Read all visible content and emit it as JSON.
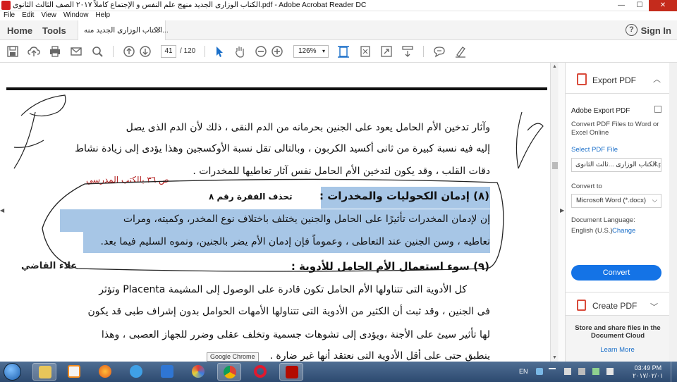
{
  "window": {
    "title": "الكتاب الوزارى الجديد منهج علم النفس و الإجتماع كاملاً ٢٠١٧ الصف الثالث الثانوى.pdf - Adobe Acrobat Reader DC",
    "min": "—",
    "max": "☐",
    "close": "✕"
  },
  "menu": [
    "File",
    "Edit",
    "View",
    "Window",
    "Help"
  ],
  "nav": {
    "home": "Home",
    "tools": "Tools",
    "tab_label": "الكتاب الوزارى الجديد منه...",
    "tab_close": "✕",
    "help": "?",
    "signin": "Sign In"
  },
  "toolbar": {
    "page_current": "41",
    "page_total": "/ 120",
    "zoom": "126%",
    "zoom_arrow": "▾",
    "icons": [
      "save-icon",
      "upload-icon",
      "print-icon",
      "mail-icon",
      "search-icon",
      "page-up-icon",
      "page-down-icon",
      "select-cursor-icon",
      "hand-icon",
      "zoom-out-icon",
      "zoom-in-icon",
      "fit-width-icon",
      "fit-page-icon",
      "full-screen-icon",
      "scroll-mode-icon",
      "comment-icon",
      "highlight-pen-icon"
    ]
  },
  "document": {
    "line1": "وآثار تدخين الأم الحامل يعود على الجنين بحرمانه من الدم النقى ، ذلك لأن الدم الذى يصل",
    "line2": "إليه فيه نسبة كبيرة من ثانى أكسيد الكربون ، وبالتالى تقل نسبة الأوكسجين وهذا يؤدى إلى زيادة نشاط",
    "line3": "دقات القلب ، وقد يكون لتدخين الأم الحامل نفس آثار تعاطيها للمخدرات .",
    "red_note": "ص ٣٦ بالكتب المدرسي",
    "heading8": "(٨) إدمان الكحوليات والمخدرات :",
    "delete_note": "تحذف الفقرة رقم ٨",
    "para8_line1": "إن لإدمان المخدرات تأثيرًا على الحامل والجنين يختلف باختلاف نوع المخدر، وكميته، ومرات",
    "para8_line2": "تعاطيه ، وسن الجنين عند التعاطى ، وعموماً فإن إدمان الأم يضر بالجنين، ونموه السليم فيما بعد.",
    "heading9": "(٩) سوء استعمال الأم الحامل للأدوية :",
    "author": "علاء القاضي",
    "p9_line1": "كل الأدوية التى تتناولها الأم الحامل تكون قادرة على الوصول إلى المشيمة Placenta وتؤثر",
    "p9_line2": "فى الجنين ، وقد ثبت أن الكثير من الأدوية التى تتناولها الأمهات الحوامل بدون إشراف طبى قد يكون",
    "p9_line3": "لها تأثير سيئ على الأجنة ،ويؤدى إلى تشوهات جسمية وتخلف عقلى وضرر للجهاز العصبى ، وهذا",
    "p9_line4": "ينطبق حتى على أقل الأدوية التى نعتقد أنها غير ضارة ."
  },
  "right_panel": {
    "export_header": "Export PDF",
    "export_chevron": "︿",
    "subtitle": "Adobe Export PDF",
    "description": "Convert PDF Files to Word or Excel Online",
    "select_label": "Select PDF File",
    "file_name": "الكتاب الوزارى ...ثالث الثانوى.pdf",
    "file_clear": "✕",
    "convert_to_label": "Convert to",
    "convert_to_value": "Microsoft Word (*.docx)",
    "dropdown_arrow": "⌵",
    "doc_lang_label": "Document Language:",
    "doc_lang_value": "English (U.S.)",
    "change_link": "Change",
    "convert_button": "Convert",
    "create_pdf": "Create PDF",
    "create_chevron": "﹀",
    "store_text": "Store and share files in the Document Cloud",
    "learn_more": "Learn More"
  },
  "taskbar": {
    "tooltip": "Google Chrome",
    "lang": "EN",
    "time": "03:49 PM",
    "date": "٢٠١٧/٠٢/٠١",
    "apps": [
      "explorer",
      "media-player",
      "firefox",
      "internet-explorer",
      "app-d",
      "app-swirl",
      "chrome",
      "opera",
      "acrobat"
    ]
  },
  "colors": {
    "highlight": "#a7c6e6",
    "accent_blue": "#1473e6",
    "red_note": "#b42020",
    "taskbar": "#2d4a70"
  }
}
